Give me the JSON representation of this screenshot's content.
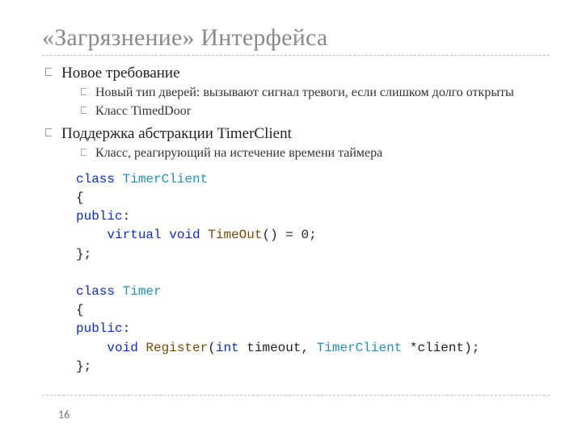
{
  "title": "«Загрязнение» Интерфейса",
  "bullets": {
    "b1": "Новое требование",
    "b1_1": "Новый тип дверей: вызывают сигнал тревоги, если слишком долго открыты",
    "b1_2": "Класс TimedDoor",
    "b2": "Поддержка абстракции TimerClient",
    "b2_1": "Класс, реагирующий на истечение времени таймера"
  },
  "code": {
    "kw_class1": "class",
    "type_tc1": "TimerClient",
    "brace_open1": "{",
    "kw_public1": "public",
    "colon1": ":",
    "indent": "    ",
    "kw_virtual": "virtual",
    "kw_void1": "void",
    "fn_timeout": "TimeOut",
    "timeout_rest": "() = 0;",
    "brace_close1": "};",
    "blank": "",
    "kw_class2": "class",
    "type_timer": "Timer",
    "brace_open2": "{",
    "kw_public2": "public",
    "colon2": ":",
    "kw_void2": "void",
    "fn_register": "Register",
    "paren_open": "(",
    "kw_int": "int",
    "arg_timeout": " timeout, ",
    "type_tc2": "TimerClient",
    "arg_client": " *client);",
    "brace_close2": "};"
  },
  "page": "16"
}
